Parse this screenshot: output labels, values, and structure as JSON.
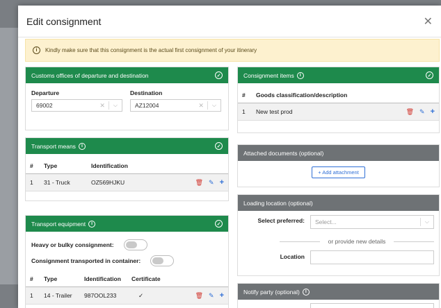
{
  "modal": {
    "title": "Edit consignment",
    "close_icon": "close-icon"
  },
  "alert": {
    "text": "Kindly make sure that this consignment is the actual first consignment of your itinerary"
  },
  "customs": {
    "title": "Customs offices of departure and destination",
    "departure_label": "Departure",
    "departure_value": "69002",
    "destination_label": "Destination",
    "destination_value": "AZ12004"
  },
  "transport_means": {
    "title": "Transport means",
    "headers": [
      "#",
      "Type",
      "Identification"
    ],
    "rows": [
      {
        "num": "1",
        "type": "31 - Truck",
        "id": "OZ569HJKU"
      }
    ]
  },
  "transport_equipment": {
    "title": "Transport equipment",
    "heavy_label": "Heavy or bulky consignment:",
    "container_label": "Consignment transported in container:",
    "headers": [
      "#",
      "Type",
      "Identification",
      "Certificate"
    ],
    "rows": [
      {
        "num": "1",
        "type": "14 - Trailer",
        "id": "987OOL233",
        "certificate": "✓"
      }
    ]
  },
  "consignment_items": {
    "title": "Consignment items",
    "headers": [
      "#",
      "Goods classification/description"
    ],
    "rows": [
      {
        "num": "1",
        "desc": "New test prod"
      }
    ]
  },
  "attached_documents": {
    "title": "Attached documents (optional)",
    "add_label": "Add attachment"
  },
  "loading_location": {
    "title": "Loading location (optional)",
    "select_label": "Select preferred:",
    "select_placeholder": "Select...",
    "or_text": "or provide new details",
    "location_label": "Location"
  },
  "notify_party": {
    "title": "Notify party (optional)"
  },
  "colors": {
    "green": "#1e8a4c",
    "gray": "#6e7275",
    "alert_bg": "#fdf1cf",
    "blue": "#2f6fd6",
    "red": "#d0342c"
  }
}
